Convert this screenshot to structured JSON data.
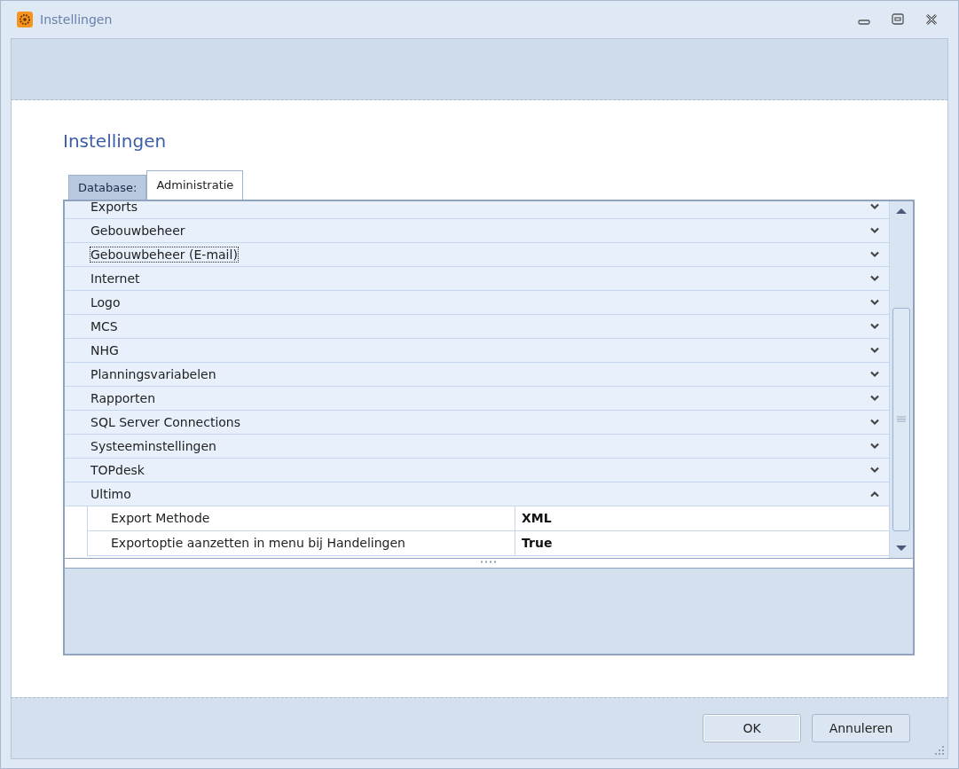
{
  "window": {
    "title": "Instellingen"
  },
  "header": {
    "title": "Instellingen"
  },
  "tabs": [
    {
      "label": "Database:",
      "selected": false
    },
    {
      "label": "Administratie",
      "selected": true
    }
  ],
  "categories": [
    {
      "name": "Exports",
      "expanded": false,
      "focused": false
    },
    {
      "name": "Gebouwbeheer",
      "expanded": false,
      "focused": false
    },
    {
      "name": "Gebouwbeheer (E-mail)",
      "expanded": false,
      "focused": true
    },
    {
      "name": "Internet",
      "expanded": false,
      "focused": false
    },
    {
      "name": "Logo",
      "expanded": false,
      "focused": false
    },
    {
      "name": "MCS",
      "expanded": false,
      "focused": false
    },
    {
      "name": "NHG",
      "expanded": false,
      "focused": false
    },
    {
      "name": "Planningsvariabelen",
      "expanded": false,
      "focused": false
    },
    {
      "name": "Rapporten",
      "expanded": false,
      "focused": false
    },
    {
      "name": "SQL Server Connections",
      "expanded": false,
      "focused": false
    },
    {
      "name": "Systeeminstellingen",
      "expanded": false,
      "focused": false
    },
    {
      "name": "TOPdesk",
      "expanded": false,
      "focused": false
    },
    {
      "name": "Ultimo",
      "expanded": true,
      "focused": false,
      "children": [
        {
          "name": "Export Methode",
          "value": "XML"
        },
        {
          "name": "Exportoptie aanzetten in menu bij Handelingen",
          "value": "True"
        }
      ]
    }
  ],
  "buttons": [
    {
      "label": "OK",
      "default": true
    },
    {
      "label": "Annuleren",
      "default": false
    }
  ]
}
